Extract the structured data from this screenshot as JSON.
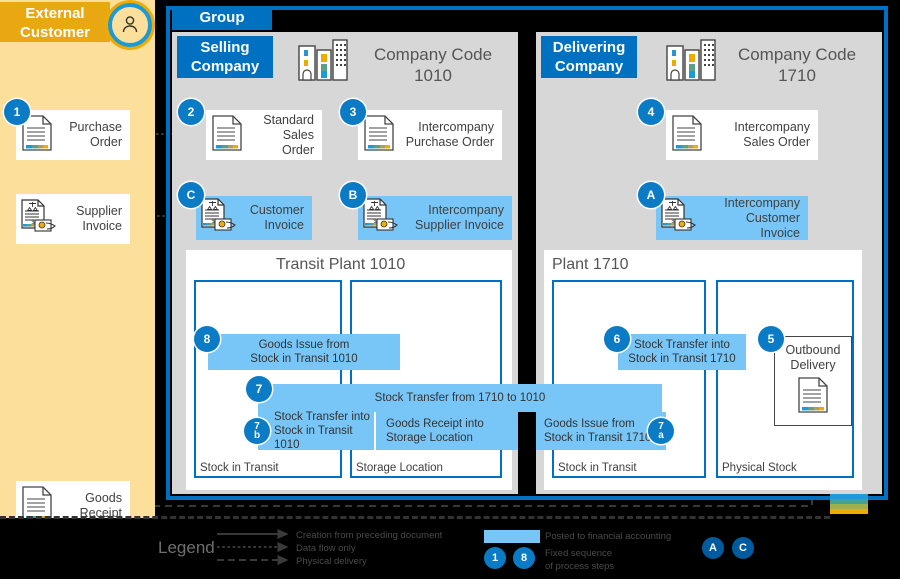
{
  "external": {
    "header": "External Customer",
    "avatar_icon": "person-icon",
    "purchase_order": "Purchase Order",
    "supplier_invoice": "Supplier Invoice",
    "goods_receipt": "Goods Receipt"
  },
  "group": {
    "tag": "Group",
    "selling": {
      "tag": "Selling Company",
      "company_code": "Company Code 1010",
      "company_code_line1": "Company Code",
      "company_code_line2": "1010",
      "building_icon": "office-building-icon"
    },
    "delivering": {
      "tag": "Delivering Company",
      "company_code": "Company Code 1710",
      "company_code_line1": "Company Code",
      "company_code_line2": "1710",
      "building_icon": "office-building-icon"
    }
  },
  "documents": [
    {
      "id": "standard-sales-order",
      "label": "Standard Sales Order",
      "badge": "2",
      "icon": "document-icon"
    },
    {
      "id": "intercompany-purchase-order",
      "label": "Intercompany Purchase Order",
      "badge": "3",
      "icon": "document-icon"
    },
    {
      "id": "intercompany-sales-order",
      "label": "Intercompany Sales Order",
      "badge": "4",
      "icon": "document-icon"
    },
    {
      "id": "customer-invoice",
      "label": "Customer Invoice",
      "badge": "C",
      "icon": "invoice-icon"
    },
    {
      "id": "intercompany-supplier-invoice",
      "label": "Intercompany Supplier Invoice",
      "badge": "B",
      "icon": "invoice-icon"
    },
    {
      "id": "intercompany-customer-invoice",
      "label": "Intercompany Customer Invoice",
      "badge": "A",
      "icon": "invoice-icon"
    },
    {
      "id": "outbound-delivery",
      "label": "Outbound Delivery",
      "badge": "5",
      "icon": "document-icon"
    }
  ],
  "plants": {
    "transit": {
      "title": "Transit Plant 1010",
      "zone_stock_in_transit": "Stock in Transit",
      "zone_storage_location": "Storage Location"
    },
    "plant1710": {
      "title": "Plant 1710",
      "zone_stock_in_transit": "Stock in Transit",
      "zone_physical_stock": "Physical Stock"
    }
  },
  "process_bars": [
    {
      "id": "goods-issue-1010",
      "badge": "8",
      "line1": "Goods Issue from",
      "line2": "Stock in Transit 1010"
    },
    {
      "id": "stock-transfer-1710-to-1010",
      "badge": "7",
      "line1": "Stock Transfer from 1710 to 1010",
      "line2": ""
    },
    {
      "id": "stock-transfer-into-transit-1010",
      "badge_num": "7",
      "badge_sub": "b",
      "line1": "Stock Transfer into",
      "line2": "Stock in Transit 1010"
    },
    {
      "id": "goods-receipt-storage-location",
      "line1": "Goods Receipt into",
      "line2": "Storage Location"
    },
    {
      "id": "goods-issue-1710",
      "badge_num": "7",
      "badge_sub": "a",
      "line1": "Goods Issue from",
      "line2": "Stock in Transit 1710"
    },
    {
      "id": "stock-transfer-into-transit-1710",
      "badge": "6",
      "line1": "Stock Transfer into",
      "line2": "Stock in Transit 1710"
    }
  ],
  "legend": {
    "title": "Legend",
    "lines": [
      {
        "style": "solid",
        "text": "Creation from preceding document"
      },
      {
        "style": "dotted",
        "text": "Data flow only"
      },
      {
        "style": "dashed",
        "text": "Physical delivery"
      }
    ],
    "swatch_text": "Posted to financial accounting",
    "sequence_line1": "Fixed sequence",
    "sequence_line2": "of process steps",
    "sequence_badges": [
      "1",
      "8"
    ],
    "letter_badges": [
      "A",
      "C"
    ]
  },
  "colors": {
    "sap_blue": "#0070c0",
    "badge_blue": "#0a7bc4",
    "light_blue": "#78c6f7",
    "amber": "#fcdf9b",
    "amber_header": "#e9a712",
    "grey_panel": "#d7d7d7",
    "arrow_grey": "#4a4a4a"
  }
}
